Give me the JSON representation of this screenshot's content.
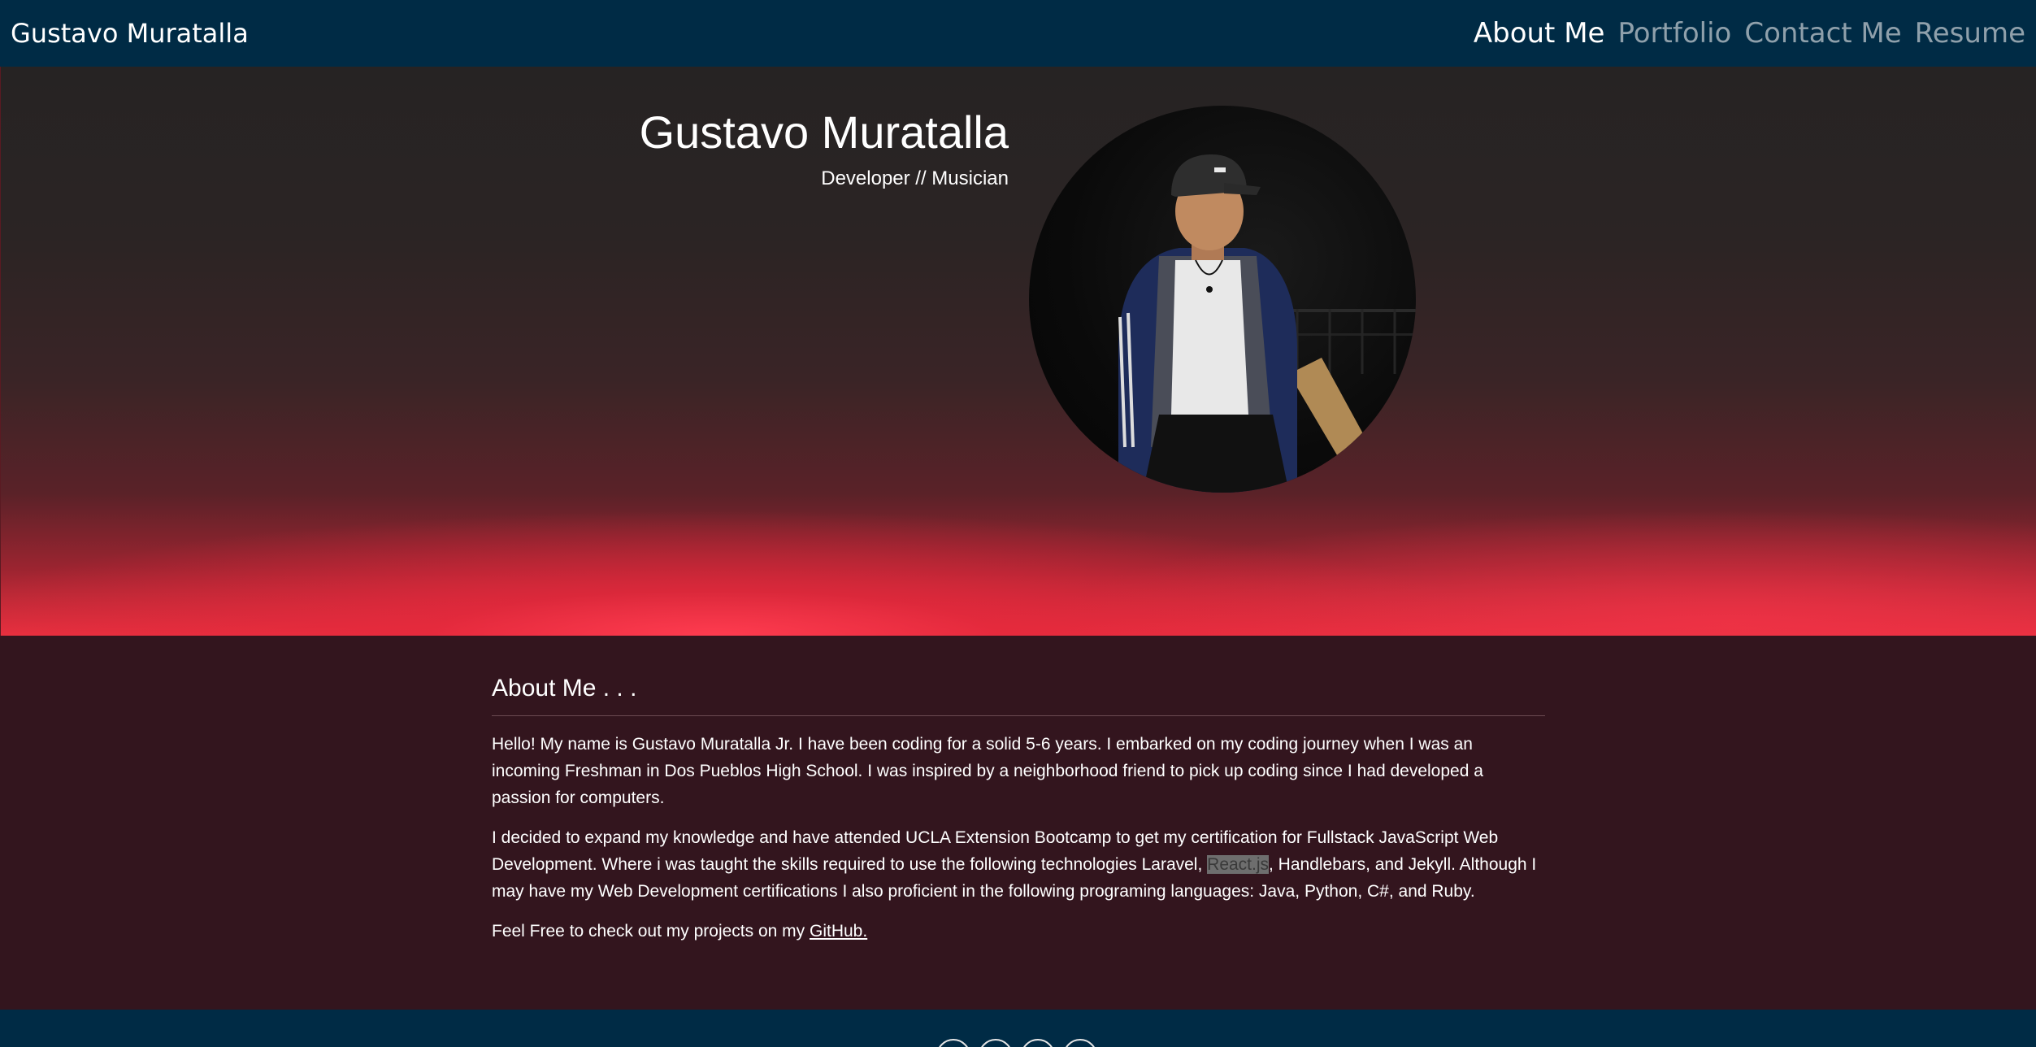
{
  "navbar": {
    "brand": "Gustavo Muratalla",
    "links": [
      {
        "label": "About Me",
        "active": true
      },
      {
        "label": "Portfolio",
        "active": false
      },
      {
        "label": "Contact Me",
        "active": false
      },
      {
        "label": "Resume",
        "active": false
      }
    ]
  },
  "hero": {
    "name": "Gustavo Muratalla",
    "subtitle": "Developer // Musician"
  },
  "about": {
    "title": "About Me . . .",
    "p1": "Hello! My name is Gustavo Muratalla Jr. I have been coding for a solid 5-6 years. I embarked on my coding journey when I was an incoming Freshman in Dos Pueblos High School. I was inspired by a neighborhood friend to pick up coding since I had developed a passion for computers.",
    "p2_before": "I decided to expand my knowledge and have attended UCLA Extension Bootcamp to get my certification for Fullstack JavaScript Web Development. Where i was taught the skills required to use the following technologies Laravel, ",
    "p2_highlight": "React.js",
    "p2_after": ", Handlebars, and Jekyll. Although I may have my Web Development certifications I also proficient in the following programing languages: Java, Python, C#, and Ruby.",
    "p3_before": "Feel Free to check out my projects on my ",
    "p3_link": "GitHub."
  },
  "footer": {
    "icons": [
      "github-icon",
      "linkedin-icon",
      "stackoverflow-icon",
      "email-icon"
    ]
  },
  "colors": {
    "navbar_bg": "#002b45",
    "about_bg": "#33151e",
    "nav_inactive": "#8fa0ab",
    "text": "#ffffff"
  }
}
